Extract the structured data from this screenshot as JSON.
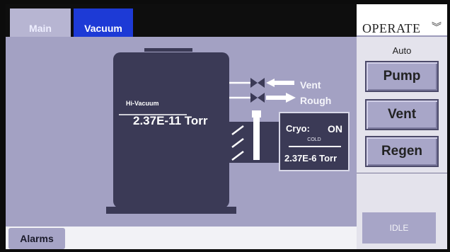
{
  "tabs": [
    {
      "label": "Main"
    },
    {
      "label": "Vacuum"
    }
  ],
  "diagram": {
    "chamber": {
      "label": "Hi-Vacuum",
      "pressure": "2.37E-11 Torr"
    },
    "vent_line": {
      "label": "Vent"
    },
    "rough_line": {
      "label": "Rough"
    },
    "cryo": {
      "name": "Cryo:",
      "status": "ON",
      "sub_status": "COLD",
      "pressure": "2.37E-6 Torr"
    }
  },
  "operate_panel": {
    "title": "OPERATE",
    "mode": "Auto",
    "buttons": {
      "pump": "Pump",
      "vent": "Vent",
      "regen": "Regen"
    },
    "state": "IDLE"
  },
  "footer": {
    "alarms_label": "Alarms"
  },
  "colors": {
    "background": "#a3a1c3",
    "chamber": "#3b3a56",
    "active_tab": "#1d3ad6",
    "button": "#a8a6c8"
  }
}
